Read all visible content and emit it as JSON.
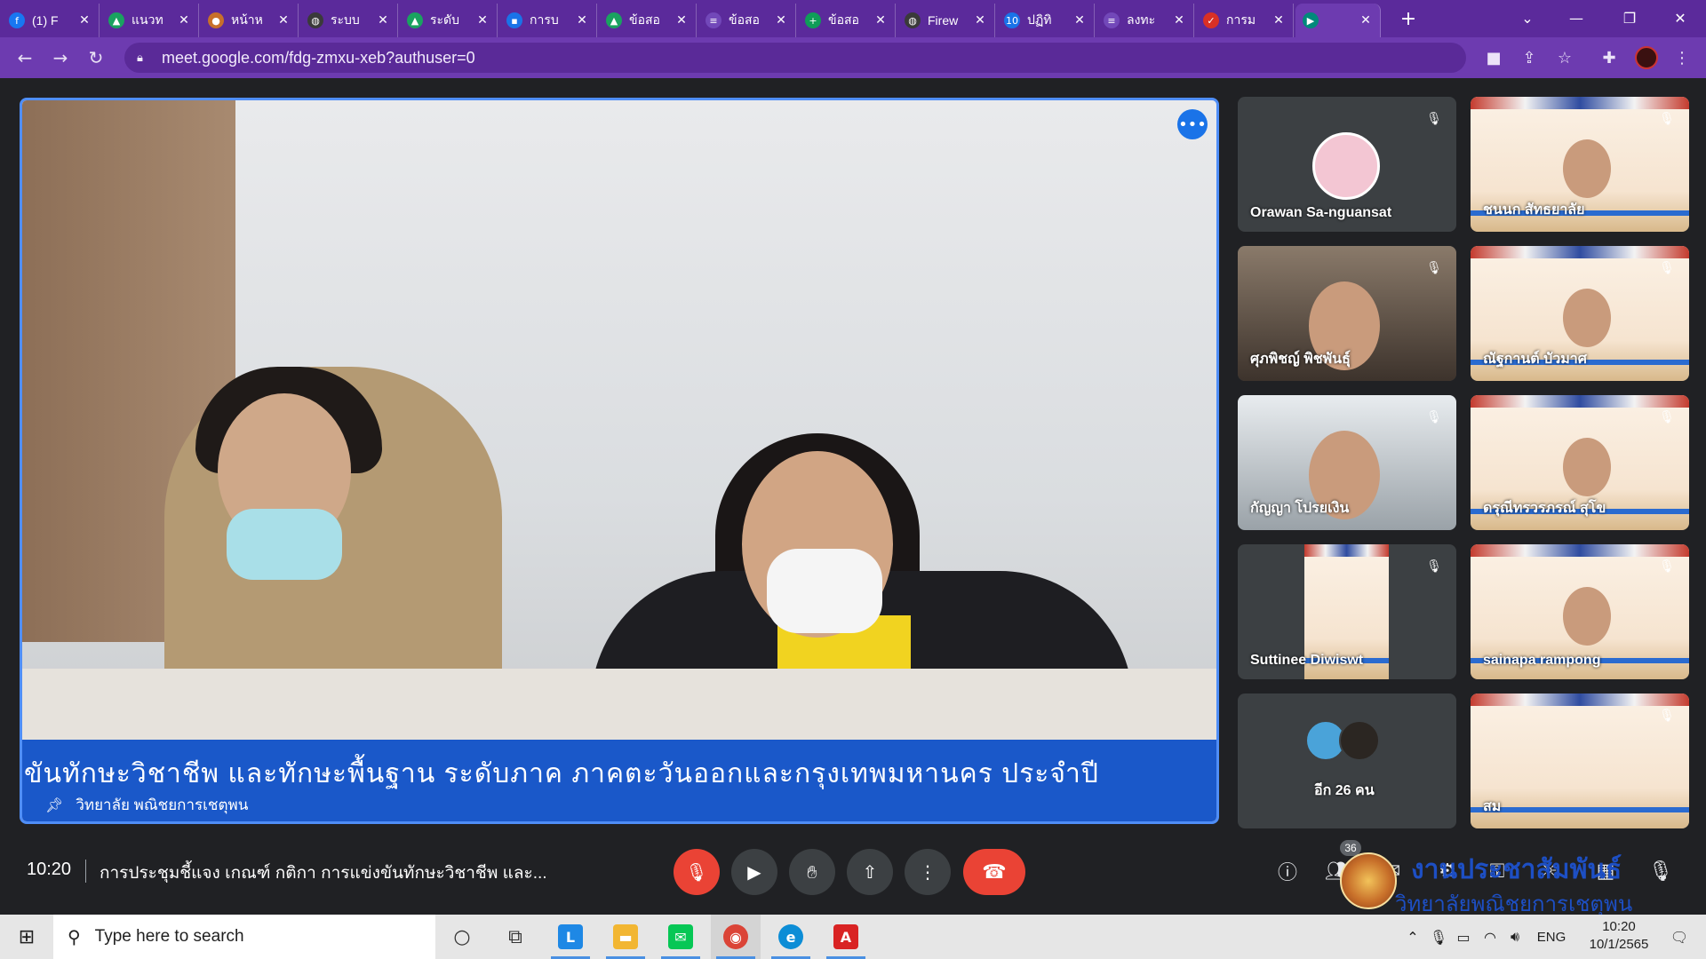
{
  "browser": {
    "tabs": [
      {
        "label": "(1) F",
        "fav_color": "#1877f2",
        "fav_glyph": "f",
        "icon": "facebook-icon",
        "active": false
      },
      {
        "label": "แนวท",
        "fav_color": "#1aa260",
        "fav_glyph": "▲",
        "icon": "drive-icon",
        "active": false
      },
      {
        "label": "หน้าห",
        "fav_color": "#c8702a",
        "fav_glyph": "●",
        "icon": "seal-icon",
        "active": false
      },
      {
        "label": "ระบบ",
        "fav_color": "#3a3a3a",
        "fav_glyph": "◍",
        "icon": "globe-icon",
        "active": false
      },
      {
        "label": "ระดับ",
        "fav_color": "#1aa260",
        "fav_glyph": "▲",
        "icon": "drive-icon",
        "active": false
      },
      {
        "label": "การบ",
        "fav_color": "#1a73e8",
        "fav_glyph": "▪",
        "icon": "contacts-icon",
        "active": false
      },
      {
        "label": "ข้อสอ",
        "fav_color": "#1aa260",
        "fav_glyph": "▲",
        "icon": "drive-icon",
        "active": false
      },
      {
        "label": "ข้อสอ",
        "fav_color": "#7248b9",
        "fav_glyph": "≡",
        "icon": "forms-icon",
        "active": false
      },
      {
        "label": "ข้อสอ",
        "fav_color": "#0f9d58",
        "fav_glyph": "+",
        "icon": "sheets-icon",
        "active": false
      },
      {
        "label": "Firew",
        "fav_color": "#3a3a3a",
        "fav_glyph": "◍",
        "icon": "globe-icon",
        "active": false
      },
      {
        "label": "ปฏิทิ",
        "fav_color": "#1a73e8",
        "fav_glyph": "10",
        "icon": "calendar-icon",
        "active": false
      },
      {
        "label": "ลงทะ",
        "fav_color": "#7248b9",
        "fav_glyph": "≡",
        "icon": "forms-icon",
        "active": false
      },
      {
        "label": "การม",
        "fav_color": "#d93025",
        "fav_glyph": "✓",
        "icon": "check-icon",
        "active": false
      },
      {
        "label": "",
        "fav_color": "#00897b",
        "fav_glyph": "▶",
        "icon": "meet-icon",
        "active": true
      }
    ],
    "url": "meet.google.com/fdg-zmxu-xeb?authuser=0"
  },
  "meet": {
    "main_banner_text": "ขันทักษะวิชาชีพ และทักษะพื้นฐาน ระดับภาค ภาคตะวันออกและกรุงเทพมหานคร ประจำปี",
    "main_speaker": "วิทยาลัย พณิชยการเชตุพน",
    "participants": [
      {
        "name": "Orawan Sa-nguansat",
        "kind": "avatar"
      },
      {
        "name": "ชนนก สัทธยาลัย",
        "kind": "poster"
      },
      {
        "name": "ศุภพิชญ์ พิชพันธุ์",
        "kind": "camera"
      },
      {
        "name": "ณัฐกานต์ บัวมาศ",
        "kind": "poster"
      },
      {
        "name": "กัญญา โปรยเงิน",
        "kind": "camera"
      },
      {
        "name": "ดรุณีทรวรภรณ์ สุโข",
        "kind": "poster"
      },
      {
        "name": "Suttinee Diwiswt",
        "kind": "poster-small"
      },
      {
        "name": "sainapa rampong",
        "kind": "poster"
      },
      {
        "name": "อีก 26 คน",
        "kind": "others"
      },
      {
        "name": "สม",
        "kind": "poster"
      }
    ],
    "time": "10:20",
    "title": "การประชุมชี้แจง เกณฑ์ กติกา การแข่งขันทักษะวิชาชีพ และ...",
    "participant_count": "36",
    "watermark_line1": "งานประชาสัมพันธ์",
    "watermark_line2": "วิทยาลัยพณิชยการเชตุพน"
  },
  "taskbar": {
    "search_placeholder": "Type here to search",
    "language": "ENG",
    "clock_time": "10:20",
    "clock_date": "10/1/2565"
  }
}
